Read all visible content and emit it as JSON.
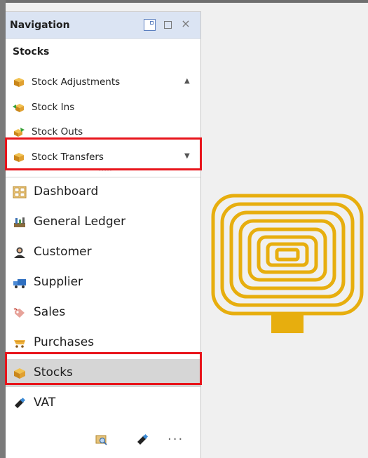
{
  "navigation": {
    "title": "Navigation",
    "group_title": "Stocks",
    "header_controls": [
      "pin-icon",
      "maximize-icon",
      "close-icon"
    ],
    "close_glyph": "×",
    "stock_items": [
      {
        "label": "Stock Adjustments",
        "icon": "box-icon"
      },
      {
        "label": "Stock Ins",
        "icon": "stock-in-icon"
      },
      {
        "label": "Stock Outs",
        "icon": "stock-out-icon"
      },
      {
        "label": "Stock Transfers",
        "icon": "box-icon"
      }
    ],
    "modules": [
      {
        "label": "Dashboard",
        "icon": "dashboard-icon"
      },
      {
        "label": "General Ledger",
        "icon": "ledger-icon"
      },
      {
        "label": "Customer",
        "icon": "customer-icon"
      },
      {
        "label": "Supplier",
        "icon": "supplier-icon"
      },
      {
        "label": "Sales",
        "icon": "sales-icon"
      },
      {
        "label": "Purchases",
        "icon": "purchases-icon"
      },
      {
        "label": "Stocks",
        "icon": "box-icon",
        "selected": true
      },
      {
        "label": "VAT",
        "icon": "vat-icon"
      }
    ],
    "bottom_more": "..."
  },
  "colors": {
    "header_bg": "#dbe4f3",
    "selected_bg": "#d6d6d6",
    "highlight": "#e8141b",
    "logo_gold": "#e7ae0e"
  }
}
